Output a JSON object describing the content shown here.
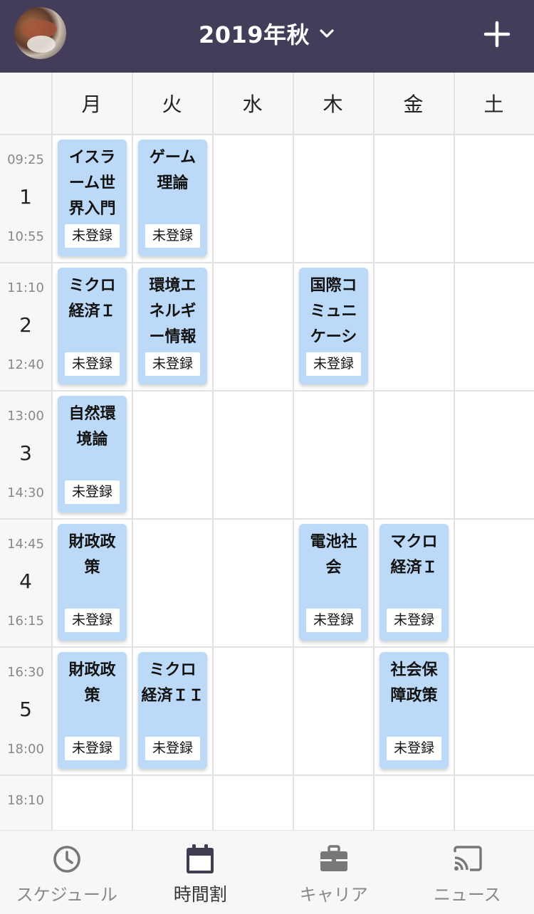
{
  "header": {
    "title": "2019年秋",
    "accent": "#433d59"
  },
  "days": [
    "月",
    "火",
    "水",
    "木",
    "金",
    "土"
  ],
  "periods": [
    {
      "number": "1",
      "start": "09:25",
      "end": "10:55"
    },
    {
      "number": "2",
      "start": "11:10",
      "end": "12:40"
    },
    {
      "number": "3",
      "start": "13:00",
      "end": "14:30"
    },
    {
      "number": "4",
      "start": "14:45",
      "end": "16:15"
    },
    {
      "number": "5",
      "start": "16:30",
      "end": "18:00"
    },
    {
      "number": "",
      "start": "18:10",
      "end": ""
    }
  ],
  "courses": [
    {
      "day": 0,
      "period": 0,
      "name": "イスラ\nーム世\n界入門",
      "status": "未登録"
    },
    {
      "day": 1,
      "period": 0,
      "name": "ゲーム\n理論",
      "status": "未登録"
    },
    {
      "day": 0,
      "period": 1,
      "name": "ミクロ\n経済Ｉ",
      "status": "未登録"
    },
    {
      "day": 1,
      "period": 1,
      "name": "環境エ\nネルギ\nー情報",
      "status": "未登録"
    },
    {
      "day": 3,
      "period": 1,
      "name": "国際コ\nミュニ\nケーシ",
      "status": "未登録"
    },
    {
      "day": 0,
      "period": 2,
      "name": "自然環\n境論",
      "status": "未登録"
    },
    {
      "day": 0,
      "period": 3,
      "name": "財政政\n策",
      "status": "未登録"
    },
    {
      "day": 3,
      "period": 3,
      "name": "電池社\n会",
      "status": "未登録"
    },
    {
      "day": 4,
      "period": 3,
      "name": "マクロ\n経済Ｉ",
      "status": "未登録"
    },
    {
      "day": 0,
      "period": 4,
      "name": "財政政\n策",
      "status": "未登録"
    },
    {
      "day": 1,
      "period": 4,
      "name": "ミクロ\n経済ＩＩ",
      "status": "未登録"
    },
    {
      "day": 4,
      "period": 4,
      "name": "社会保\n障政策",
      "status": "未登録"
    }
  ],
  "bottom_nav": [
    {
      "label": "スケジュール",
      "icon": "clock-icon",
      "active": false
    },
    {
      "label": "時間割",
      "icon": "calendar-icon",
      "active": true
    },
    {
      "label": "キャリア",
      "icon": "briefcase-icon",
      "active": false
    },
    {
      "label": "ニュース",
      "icon": "cast-icon",
      "active": false
    }
  ]
}
